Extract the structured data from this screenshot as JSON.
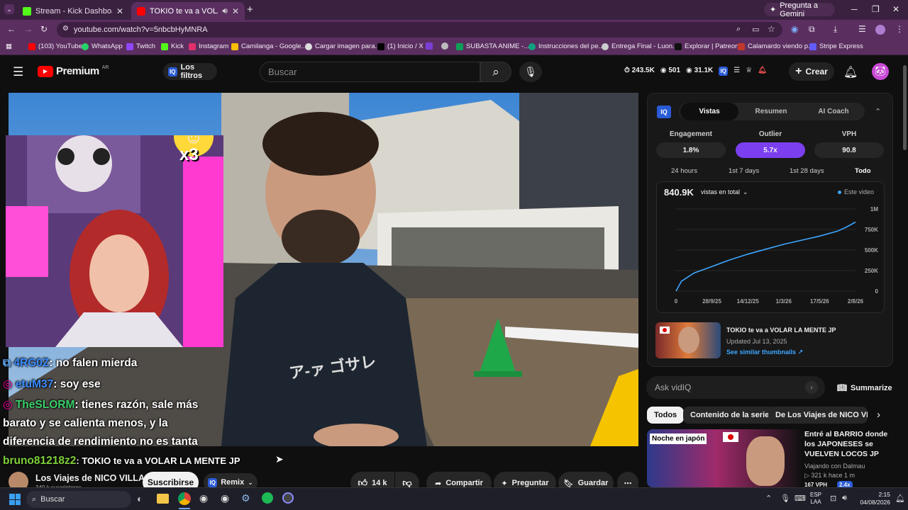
{
  "browser": {
    "tabs": [
      {
        "title": "Stream - Kick Dashboard"
      },
      {
        "title": "TOKIO te va a VOLAR LA MENTE JP"
      }
    ],
    "gemini_label": "Pregunta a Gemini",
    "url": "youtube.com/watch?v=5nbcbHyMNRA",
    "bookmarks": [
      "(103) YouTube",
      "WhatsApp",
      "Twitch",
      "Kick",
      "Instagram",
      "Camilanga - Google...",
      "Cargar imagen para...",
      "(1) Inicio / X",
      "SUBASTA ANIME -...",
      "Instrucciones del pe...",
      "Entrega Final - Luon...",
      "Explorar | Patreon",
      "Calamardo viendo p...",
      "Stripe Express"
    ]
  },
  "youtube": {
    "logo_label": "Premium",
    "region": "AR",
    "filters_label": "Los filtros",
    "search_placeholder": "Buscar",
    "stats": {
      "views": "243.5K",
      "watching": "501",
      "likes": "31.1K"
    },
    "create_label": "Crear"
  },
  "stream_overlay": {
    "emote_counter": "x3",
    "chat": [
      {
        "user": "4RG0Z",
        "text": ": no falen mierda"
      },
      {
        "user": "etuM37",
        "text": ": soy ese"
      },
      {
        "user": "TheSLORM",
        "text": ": tienes razón, sale más barato y se calienta menos, y la diferencia de rendimiento no es tanta"
      },
      {
        "user": "bruno81218z2",
        "text": ": TOKIO te va a VOLAR LA MENTE JP"
      }
    ],
    "hoodie_text": "ア-ァ ゴサレ"
  },
  "vidiq": {
    "tabs": [
      "Vistas",
      "Resumen",
      "AI Coach"
    ],
    "kpis": [
      {
        "label": "Engagement",
        "value": "1.8%"
      },
      {
        "label": "Outlier",
        "value": "5.7x"
      },
      {
        "label": "VPH",
        "value": "90.8"
      }
    ],
    "ranges": [
      "24 hours",
      "1st 7 days",
      "1st 28 days",
      "Todo"
    ],
    "total_views": "840.9K",
    "views_dropdown": "vistas en total",
    "legend": "Este video",
    "video_card": {
      "title": "TOKIO te va a VOLAR LA MENTE JP",
      "updated": "Updated Jul 13, 2025",
      "link": "See similar thumbnails"
    }
  },
  "chart_data": {
    "type": "line",
    "title": "",
    "xlabel": "",
    "ylabel": "",
    "x_ticks": [
      "0",
      "28/9/25",
      "14/12/25",
      "1/3/26",
      "17/5/26",
      "2/8/26"
    ],
    "y_ticks": [
      "0",
      "250K",
      "500K",
      "750K",
      "1M"
    ],
    "ylim": [
      0,
      1000000
    ],
    "grid": true,
    "legend_position": "top-right",
    "series": [
      {
        "name": "Este video",
        "color": "#3ea6ff",
        "x": [
          0,
          0.03,
          0.1,
          0.2,
          0.3,
          0.4,
          0.5,
          0.6,
          0.7,
          0.8,
          0.9,
          0.95,
          1.0
        ],
        "values": [
          0,
          120000,
          220000,
          300000,
          380000,
          450000,
          510000,
          570000,
          620000,
          670000,
          730000,
          780000,
          840900
        ]
      }
    ]
  },
  "sidebar": {
    "ask_placeholder": "Ask vidIQ",
    "summarize_label": "Summarize",
    "chips": [
      "Todos",
      "Contenido de la serie",
      "De Los Viajes de NICO VILLA"
    ],
    "rec": {
      "thumb_text": "Noche en japón",
      "title": "Entré al BARRIO donde los JAPONESES se VUELVEN LOCOS JP",
      "channel": "Viajando con Dalmau",
      "meta": "321 k   hace 1 m",
      "vph": "167 VPH",
      "outlier": "2.4x"
    }
  },
  "video_info": {
    "channel": "Los Viajes de NICO VILLA",
    "subscribers": "349 k suscriptores",
    "subscribe_label": "Suscribirse",
    "remix_label": "Remix",
    "likes": "14 k",
    "share_label": "Compartir",
    "ask_label": "Preguntar",
    "save_label": "Guardar"
  },
  "taskbar": {
    "search_placeholder": "Buscar",
    "lang": "ESP",
    "lang2": "LAA",
    "time": "2:15",
    "date": "04/08/2026"
  }
}
